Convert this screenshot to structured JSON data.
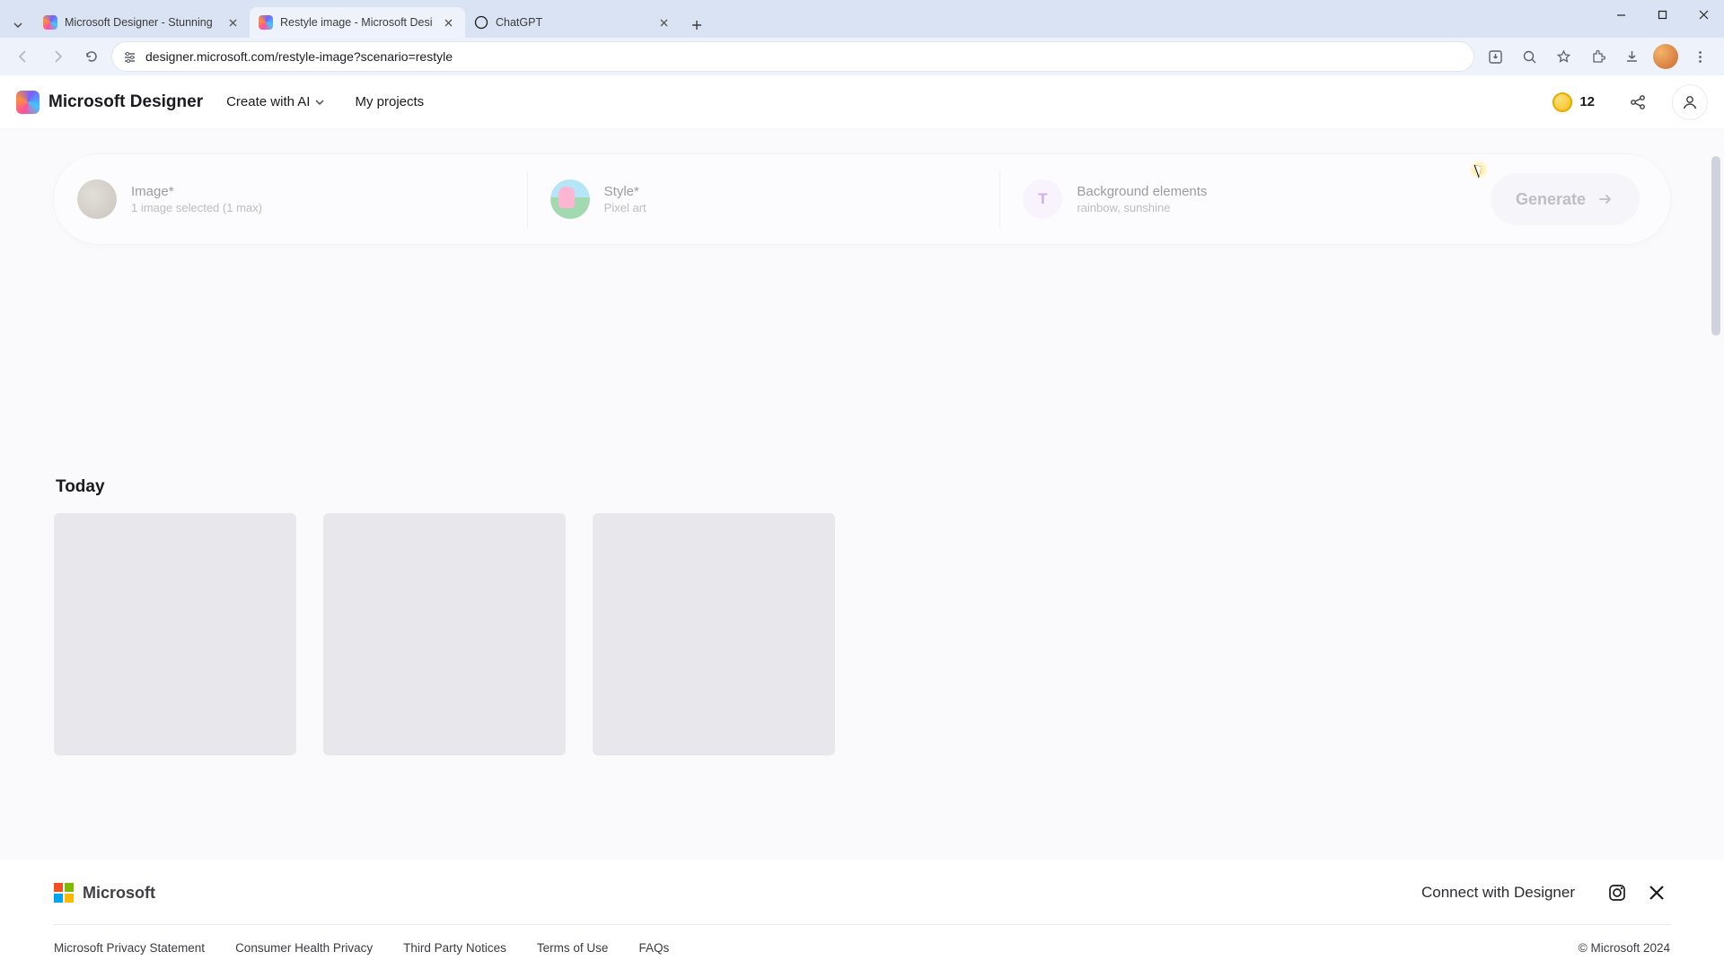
{
  "browser": {
    "tabs": [
      {
        "title": "Microsoft Designer - Stunning",
        "active": false,
        "favicon": "designer"
      },
      {
        "title": "Restyle image - Microsoft Desi",
        "active": true,
        "favicon": "designer"
      },
      {
        "title": "ChatGPT",
        "active": false,
        "favicon": "chatgpt"
      }
    ],
    "url": "designer.microsoft.com/restyle-image?scenario=restyle"
  },
  "header": {
    "brand": "Microsoft Designer",
    "nav": {
      "create": "Create with AI",
      "projects": "My projects"
    },
    "coins": "12"
  },
  "prompt": {
    "image": {
      "title": "Image*",
      "sub": "1 image selected (1 max)"
    },
    "style": {
      "title": "Style*",
      "sub": "Pixel art"
    },
    "bg": {
      "title": "Background elements",
      "sub": "rainbow, sunshine"
    },
    "generate": "Generate"
  },
  "section": {
    "today": "Today"
  },
  "footer": {
    "brand": "Microsoft",
    "connect": "Connect with Designer",
    "links": [
      "Microsoft Privacy Statement",
      "Consumer Health Privacy",
      "Third Party Notices",
      "Terms of Use",
      "FAQs"
    ],
    "copyright": "© Microsoft 2024"
  }
}
